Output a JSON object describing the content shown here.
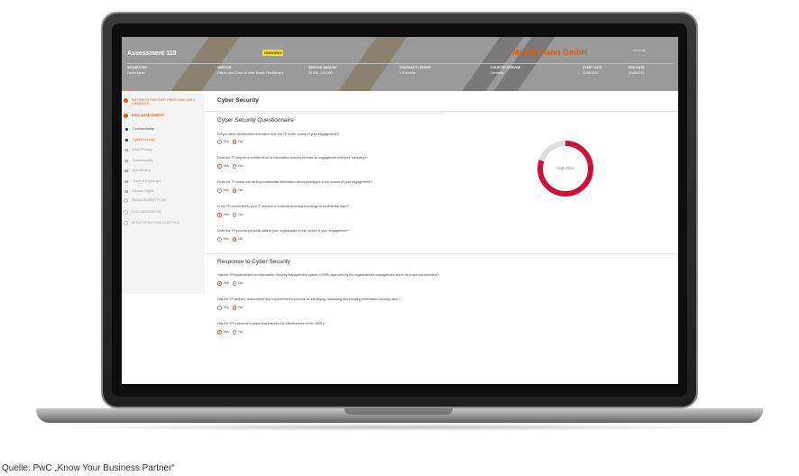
{
  "header": {
    "title": "Assessment 119",
    "badge": "ONGOING",
    "company": "Mustermann GmbH",
    "arrow": "⟶",
    "meta": [
      {
        "label": "REQUESTER",
        "value": "Daniel Meier"
      },
      {
        "label": "SERVICE",
        "value": "Offices and Clinics of other Health Practitioners"
      },
      {
        "label": "SERVICE AMOUNT",
        "value": "20 000 - 100 000"
      },
      {
        "label": "CONTRACT LENGHT",
        "value": "< 6 months"
      },
      {
        "label": "COUNTRY SERVICE",
        "value": "Germany"
      },
      {
        "label": "START DATE",
        "value": "01/06/2021"
      },
      {
        "label": "END DATE",
        "value": "31/05/2021"
      }
    ]
  },
  "sidebar": {
    "steps": [
      {
        "label": "BUSINESS PARTNER PROFILING DATA CREATION"
      },
      {
        "label": "RISK ASSESSMENT"
      },
      {
        "label": "Confidentiality"
      },
      {
        "label": "Cyber Security"
      },
      {
        "label": "Data Privacy"
      },
      {
        "label": "Sustainability"
      },
      {
        "label": "Anti-Bribery"
      },
      {
        "label": "Trade & Embargos"
      },
      {
        "label": "Human Rights"
      },
      {
        "label": "MANAGEMENT PLAN"
      },
      {
        "label": "DOCUMENTATION"
      },
      {
        "label": "MONITORING AND AUDITING"
      }
    ]
  },
  "main": {
    "title": "Cyber Security",
    "questionnaire": {
      "title": "Cyber Security Questionnaire",
      "questions": [
        {
          "text": "Do you store confidential information with the TP in the course of your engagement?*",
          "selected": "No"
        },
        {
          "text": "Does the TP require a certified level of information security to enter an engagement with your company?*",
          "selected": "Yes"
        },
        {
          "text": "Does the TP works with strictly confidential information about prototypes in the course of your engagement?*",
          "selected": "No"
        },
        {
          "text": "Is the TP connected to your IT network or a similar technical exchange of confidential data?*",
          "selected": "Yes"
        },
        {
          "text": "Does the TP process personal data of your organization in the course of your engagement?*",
          "selected": "No"
        }
      ]
    },
    "response": {
      "title": "Response to Cyber Security",
      "questions": [
        {
          "text": "Has the TP implemented an Information Security Management System (ISMS) approved by the organization's management and is its scope documented?*",
          "selected": "Yes"
        },
        {
          "text": "Has the TP defined, documented and implemented a process for identifying, assessing and handling information security risks?*",
          "selected": "No"
        },
        {
          "text": "Has the TP a process in place that ensures the effectiveness of the ISMS?*",
          "selected": "Yes"
        }
      ]
    },
    "option_yes": "Yes",
    "option_no": "No",
    "risk": {
      "label": "High Risk",
      "level": 0.8,
      "color": "#d0103a"
    }
  },
  "caption": "Quelle: PwC „Know Your Business Partner“"
}
